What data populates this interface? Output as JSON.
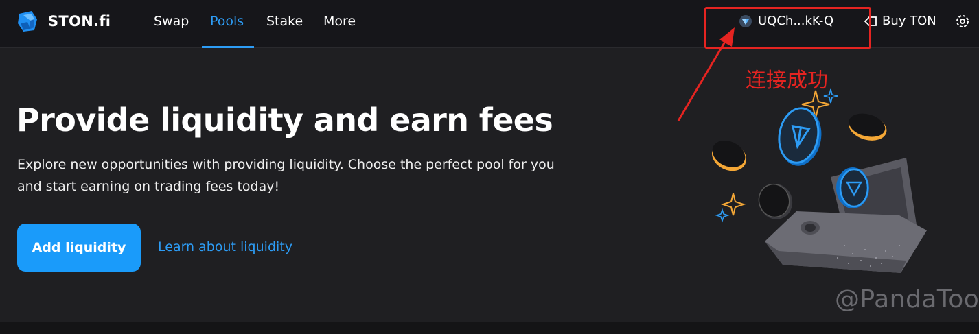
{
  "header": {
    "brand": "STON.fi",
    "nav": [
      {
        "label": "Swap"
      },
      {
        "label": "Pools"
      },
      {
        "label": "Stake"
      },
      {
        "label": "More"
      }
    ],
    "active_nav": "Pools",
    "wallet_address": "UQCh...kK-Q",
    "buy_label": "Buy TON",
    "settings_icon": "gear-icon"
  },
  "annotation": {
    "text": "连接成功",
    "color": "#e52421"
  },
  "hero": {
    "title": "Provide liquidity and earn fees",
    "description": "Explore new opportunities with providing liquidity. Choose the perfect pool for you and start earning on trading fees today!",
    "primary_button": "Add liquidity",
    "secondary_link": "Learn about liquidity"
  },
  "watermark": "@PandaTool",
  "colors": {
    "background": "#1f1f22",
    "header": "#16161a",
    "accent": "#1a9bfa",
    "annotation": "#e52421"
  }
}
